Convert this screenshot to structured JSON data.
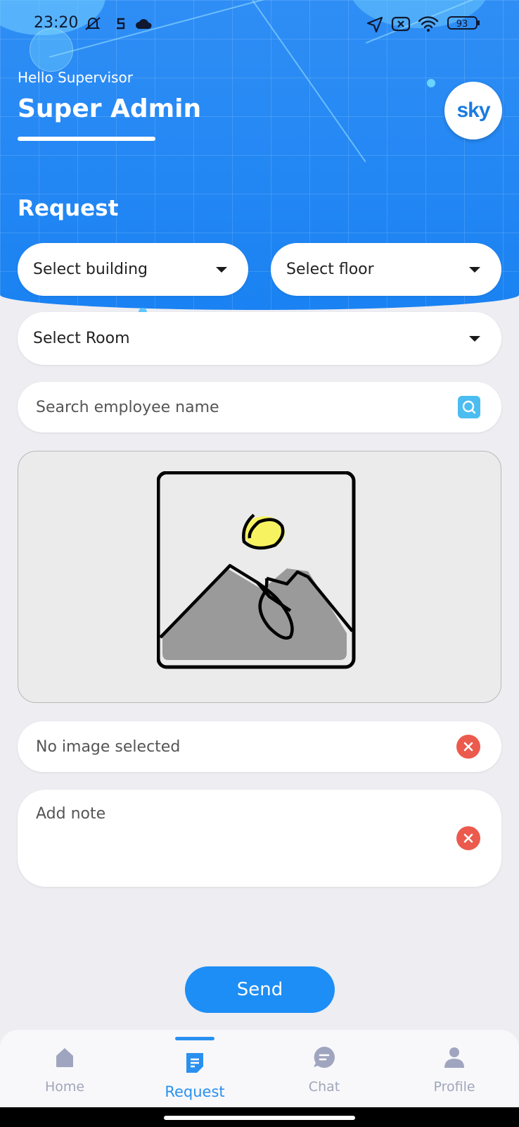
{
  "status_bar": {
    "time": "23:20",
    "battery": "93",
    "icons": [
      "mute-icon",
      "s-icon",
      "cloud-icon",
      "location-icon",
      "close-box-icon",
      "wifi-icon",
      "battery-icon"
    ]
  },
  "header": {
    "greeting": "Hello Supervisor",
    "user_name": "Super Admin",
    "logo_text": "sky"
  },
  "form": {
    "section_title": "Request",
    "building_label": "Select building",
    "floor_label": "Select floor",
    "room_label": "Select Room",
    "search_placeholder": "Search employee name",
    "image_status": "No image selected",
    "note_placeholder": "Add note",
    "send_label": "Send"
  },
  "nav": {
    "items": [
      {
        "label": "Home",
        "icon": "home-icon"
      },
      {
        "label": "Request",
        "icon": "request-icon"
      },
      {
        "label": "Chat",
        "icon": "chat-icon"
      },
      {
        "label": "Profile",
        "icon": "profile-icon"
      }
    ],
    "active": "Request"
  },
  "colors": {
    "header_blue": "#1a82f2",
    "accent": "#2a90ef",
    "clear_red": "#eb5a4d",
    "search_cyan": "#4cbdf0"
  }
}
